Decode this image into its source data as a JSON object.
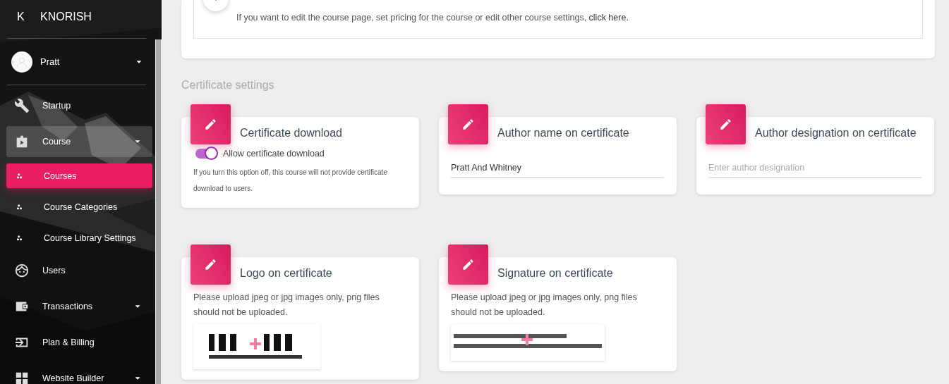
{
  "sidebar": {
    "logo_letter": "K",
    "brand": "KNORISH",
    "user": {
      "name": "Pratt",
      "dropdown": true
    },
    "items": [
      {
        "label": "Startup",
        "kind": "item",
        "selected": false,
        "highlighted": false,
        "dropdown": false
      },
      {
        "label": "Course",
        "kind": "item",
        "selected": false,
        "highlighted": true,
        "dropdown": true
      },
      {
        "label": "Courses",
        "kind": "subitem",
        "selected": true,
        "highlighted": false,
        "dropdown": false
      },
      {
        "label": "Course Categories",
        "kind": "subitem",
        "selected": false,
        "highlighted": false,
        "dropdown": false
      },
      {
        "label": "Course Library Settings",
        "kind": "subitem",
        "selected": false,
        "highlighted": false,
        "dropdown": false
      },
      {
        "label": "Users",
        "kind": "item",
        "selected": false,
        "highlighted": false,
        "dropdown": false
      },
      {
        "label": "Transactions",
        "kind": "item",
        "selected": false,
        "highlighted": false,
        "dropdown": true
      },
      {
        "label": "Plan & Billing",
        "kind": "item",
        "selected": false,
        "highlighted": false,
        "dropdown": false
      },
      {
        "label": "Website Builder",
        "kind": "item",
        "selected": false,
        "highlighted": false,
        "dropdown": true
      }
    ]
  },
  "notice": {
    "text": "If you want to edit the course page, set pricing for the course or edit other course settings, ",
    "link": "click here",
    "after": "."
  },
  "section_title": "Certificate settings",
  "cards": [
    {
      "kind": "toggle",
      "title": "Certificate download",
      "toggle": {
        "label": "Allow certificate download",
        "on": true
      },
      "help": "If you turn this option off, this course will not provide certificate download to users."
    },
    {
      "kind": "text",
      "title": "Author name on certificate",
      "value": "Pratt And Whitney"
    },
    {
      "kind": "text",
      "title": "Author designation on certificate",
      "placeholder": "Enter author designation"
    },
    {
      "title": "Logo on certificate",
      "help": "Please upload jpeg or jpg images only, png files should not be uploaded."
    },
    {
      "title": "Signature on certificate",
      "help": "Please upload jpeg or jpg images only, png files should not be uploaded."
    }
  ]
}
